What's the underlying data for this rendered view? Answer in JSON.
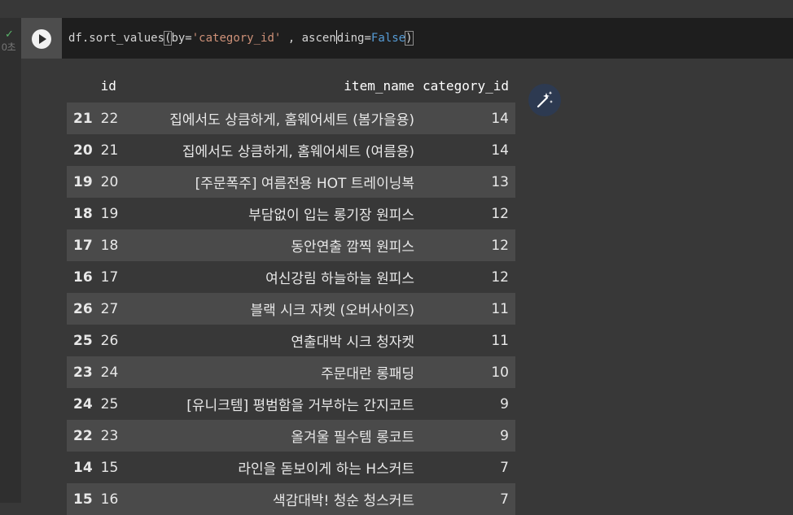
{
  "cell": {
    "status_check": "✓",
    "status_time": "0초",
    "code_prefix": "df.sort_values",
    "code_open": "(",
    "code_by": "by=",
    "code_by_value": "'category_id'",
    "code_sep": " , ascen",
    "code_sep2": "ding=",
    "code_false": "False",
    "code_close": ")"
  },
  "table": {
    "columns": [
      "",
      "id",
      "item_name",
      "category_id"
    ],
    "rows": [
      {
        "index": "21",
        "id": "22",
        "item_name": "집에서도 상큼하게, 홈웨어세트 (봄가을용)",
        "category_id": "14"
      },
      {
        "index": "20",
        "id": "21",
        "item_name": "집에서도 상큼하게, 홈웨어세트 (여름용)",
        "category_id": "14"
      },
      {
        "index": "19",
        "id": "20",
        "item_name": "[주문폭주] 여름전용 HOT 트레이닝복",
        "category_id": "13"
      },
      {
        "index": "18",
        "id": "19",
        "item_name": "부담없이 입는 롱기장 원피스",
        "category_id": "12"
      },
      {
        "index": "17",
        "id": "18",
        "item_name": "동안연출 깜찍 원피스",
        "category_id": "12"
      },
      {
        "index": "16",
        "id": "17",
        "item_name": "여신강림 하늘하늘 원피스",
        "category_id": "12"
      },
      {
        "index": "26",
        "id": "27",
        "item_name": "블랙 시크 자켓 (오버사이즈)",
        "category_id": "11"
      },
      {
        "index": "25",
        "id": "26",
        "item_name": "연출대박 시크 청자켓",
        "category_id": "11"
      },
      {
        "index": "23",
        "id": "24",
        "item_name": "주문대란 롱패딩",
        "category_id": "10"
      },
      {
        "index": "24",
        "id": "25",
        "item_name": "[유니크템] 평범함을 거부하는 간지코트",
        "category_id": "9"
      },
      {
        "index": "22",
        "id": "23",
        "item_name": "올겨울 필수템 롱코트",
        "category_id": "9"
      },
      {
        "index": "14",
        "id": "15",
        "item_name": "라인을 돋보이게 하는 H스커트",
        "category_id": "7"
      },
      {
        "index": "15",
        "id": "16",
        "item_name": "색감대박! 청순 청스커트",
        "category_id": "7"
      }
    ]
  },
  "icons": {
    "run": "play-icon",
    "magic": "magic-wand-icon"
  }
}
